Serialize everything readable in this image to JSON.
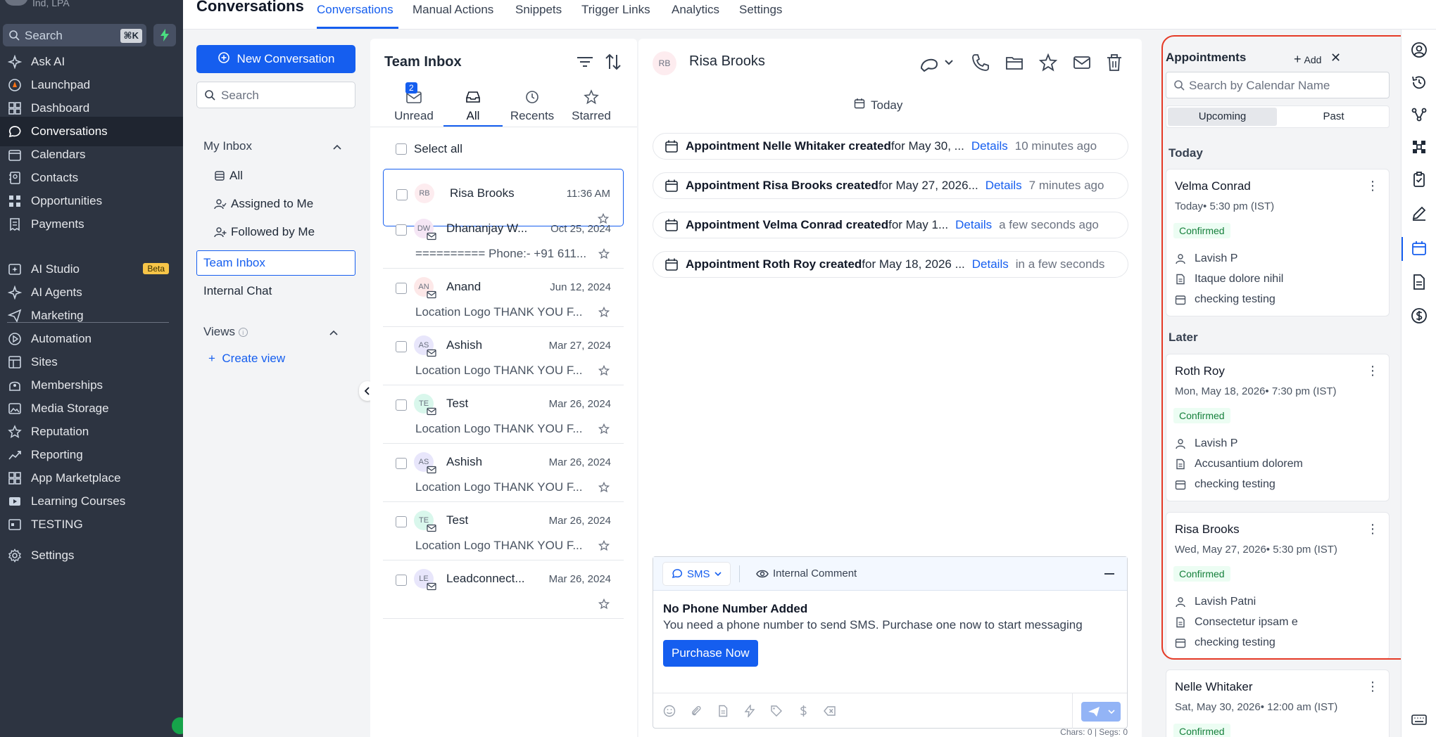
{
  "sidebar": {
    "location": "Ind, LPA",
    "search_placeholder": "Search",
    "search_shortcut": "⌘K",
    "items": [
      {
        "label": "Ask AI",
        "icon": "sparkle-icon"
      },
      {
        "label": "Launchpad",
        "icon": "launchpad-icon"
      },
      {
        "label": "Dashboard",
        "icon": "dashboard-icon"
      },
      {
        "label": "Conversations",
        "icon": "chat-icon"
      },
      {
        "label": "Calendars",
        "icon": "calendar-icon"
      },
      {
        "label": "Contacts",
        "icon": "contacts-icon"
      },
      {
        "label": "Opportunities",
        "icon": "opportunities-icon"
      },
      {
        "label": "Payments",
        "icon": "payments-icon"
      },
      {
        "label": "AI Studio",
        "icon": "ai-studio-icon",
        "badge": "Beta"
      },
      {
        "label": "AI Agents",
        "icon": "sparkle-icon"
      },
      {
        "label": "Marketing",
        "icon": "send-icon"
      },
      {
        "label": "Automation",
        "icon": "automation-icon"
      },
      {
        "label": "Sites",
        "icon": "sites-icon"
      },
      {
        "label": "Memberships",
        "icon": "memberships-icon"
      },
      {
        "label": "Media Storage",
        "icon": "media-icon"
      },
      {
        "label": "Reputation",
        "icon": "star-icon"
      },
      {
        "label": "Reporting",
        "icon": "reporting-icon"
      },
      {
        "label": "App Marketplace",
        "icon": "marketplace-icon"
      },
      {
        "label": "Learning Courses",
        "icon": "video-icon"
      },
      {
        "label": "TESTING",
        "icon": "testing-icon"
      },
      {
        "label": "Settings",
        "icon": "gear-icon"
      }
    ]
  },
  "topbar": {
    "title": "Conversations",
    "tabs": [
      "Conversations",
      "Manual Actions",
      "Snippets",
      "Trigger Links",
      "Analytics",
      "Settings"
    ]
  },
  "inbox_nav": {
    "new_conversation": "New Conversation",
    "search_placeholder": "Search",
    "my_inbox": "My Inbox",
    "all": "All",
    "assigned": "Assigned to Me",
    "followed": "Followed by Me",
    "team_inbox": "Team Inbox",
    "internal_chat": "Internal Chat",
    "views": "Views",
    "create_view": "Create view"
  },
  "conv_list": {
    "title": "Team Inbox",
    "tabs": [
      {
        "label": "Unread",
        "badge": "2"
      },
      {
        "label": "All"
      },
      {
        "label": "Recents"
      },
      {
        "label": "Starred"
      }
    ],
    "select_all": "Select all",
    "rows": [
      {
        "initials": "RB",
        "name": "Risa Brooks",
        "time": "11:36 AM",
        "preview": "",
        "avatar_bg": "#fdecef"
      },
      {
        "initials": "DW",
        "name": "Dhananjay W...",
        "time": "Oct 25, 2024",
        "preview": "========== Phone:- +91 611...",
        "avatar_bg": "#f5e6f5"
      },
      {
        "initials": "AN",
        "name": "Anand",
        "time": "Jun 12, 2024",
        "preview": "Location Logo THANK YOU F...",
        "avatar_bg": "#fde8e8"
      },
      {
        "initials": "AS",
        "name": "Ashish",
        "time": "Mar 27, 2024",
        "preview": "Location Logo THANK YOU F...",
        "avatar_bg": "#e8e6fb"
      },
      {
        "initials": "TE",
        "name": "Test",
        "time": "Mar 26, 2024",
        "preview": "Location Logo THANK YOU F...",
        "avatar_bg": "#d9f7ec"
      },
      {
        "initials": "AS",
        "name": "Ashish",
        "time": "Mar 26, 2024",
        "preview": "Location Logo THANK YOU F...",
        "avatar_bg": "#e8e6fb"
      },
      {
        "initials": "TE",
        "name": "Test",
        "time": "Mar 26, 2024",
        "preview": "Location Logo THANK YOU F...",
        "avatar_bg": "#d9f7ec"
      },
      {
        "initials": "LE",
        "name": "Leadconnect...",
        "time": "Mar 26, 2024",
        "preview": "",
        "avatar_bg": "#e8e6fb"
      }
    ]
  },
  "conv_view": {
    "contact_initials": "RB",
    "contact_name": "Risa Brooks",
    "date_divider": "Today",
    "events": [
      {
        "bold": "Appointment Nelle Whitaker created",
        "rest": " for May 30, ...",
        "details": "Details",
        "ago": "10 minutes ago"
      },
      {
        "bold": "Appointment Risa Brooks created",
        "rest": " for May 27, 2026...",
        "details": "Details",
        "ago": "7 minutes ago"
      },
      {
        "bold": "Appointment Velma Conrad created",
        "rest": " for May 1...",
        "details": "Details",
        "ago": "a few seconds ago"
      },
      {
        "bold": "Appointment Roth Roy created",
        "rest": " for May 18, 2026 ...",
        "details": "Details",
        "ago": "in a few seconds"
      }
    ],
    "composer": {
      "channel": "SMS",
      "internal_comment": "Internal Comment",
      "no_phone_title": "No Phone Number Added",
      "no_phone_desc": "You need a phone number to send SMS. Purchase one now to start messaging",
      "purchase": "Purchase Now",
      "counter": "Chars: 0 | Segs: 0"
    }
  },
  "appointments": {
    "title": "Appointments",
    "add": "Add",
    "search_placeholder": "Search by Calendar Name",
    "seg_upcoming": "Upcoming",
    "seg_past": "Past",
    "group_today": "Today",
    "group_later": "Later",
    "cards": [
      {
        "name": "Velma Conrad",
        "when": "Today• 5:30 pm (IST)",
        "status": "Confirmed",
        "user": "Lavish P",
        "title": "Itaque dolore nihil",
        "calendar": "checking testing"
      },
      {
        "name": "Roth Roy",
        "when": "Mon, May 18, 2026• 7:30 pm (IST)",
        "status": "Confirmed",
        "user": "Lavish P",
        "title": "Accusantium dolorem",
        "calendar": "checking testing"
      },
      {
        "name": "Risa Brooks",
        "when": "Wed, May 27, 2026• 5:30 pm (IST)",
        "status": "Confirmed",
        "user": "Lavish Patni",
        "title": "Consectetur ipsam e",
        "calendar": "checking testing"
      },
      {
        "name": "Nelle Whitaker",
        "when": "Sat, May 30, 2026• 12:00 am (IST)",
        "status": "Confirmed",
        "user": "",
        "title": "",
        "calendar": ""
      }
    ]
  },
  "colors": {
    "accent": "#155eef",
    "sidebar_bg": "#2d3441",
    "highlight_outline": "#e53a26",
    "confirmed": "#16803c"
  }
}
